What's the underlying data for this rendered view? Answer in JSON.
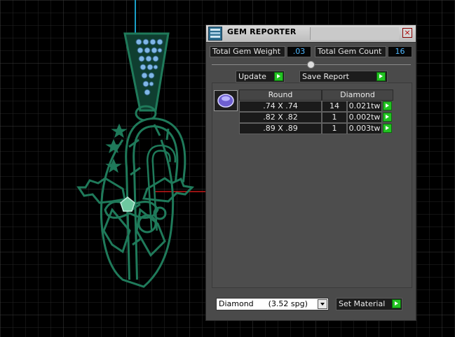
{
  "panel": {
    "title": "GEM REPORTER",
    "close_label": "×",
    "total_gem_weight_label": "Total Gem Weight",
    "total_gem_weight_value": ".03",
    "total_gem_count_label": "Total Gem Count",
    "total_gem_count_value": "16",
    "update_label": "Update",
    "save_report_label": "Save Report",
    "table": {
      "header_shape": "Round",
      "header_material": "Diamond",
      "rows": [
        {
          "size": ".74 X .74",
          "count": "14",
          "weight": "0.021tw"
        },
        {
          "size": ".82 X .82",
          "count": "1",
          "weight": "0.002tw"
        },
        {
          "size": ".89 X .89",
          "count": "1",
          "weight": "0.003tw"
        }
      ]
    },
    "material_selected": "Diamond      (3.52 spg)",
    "set_material_label": "Set Material"
  },
  "colors": {
    "model": "#1f7a5a",
    "grid": "#2e2e2e",
    "axis_blue": "#1aa0c8",
    "axis_red": "#c81818",
    "value_text": "#4fb8ff",
    "go_button": "#22c322"
  },
  "icons": {
    "app": "gem-reporter-icon",
    "close": "close-icon",
    "go": "play-arrow-icon",
    "gem": "round-gem-icon"
  }
}
